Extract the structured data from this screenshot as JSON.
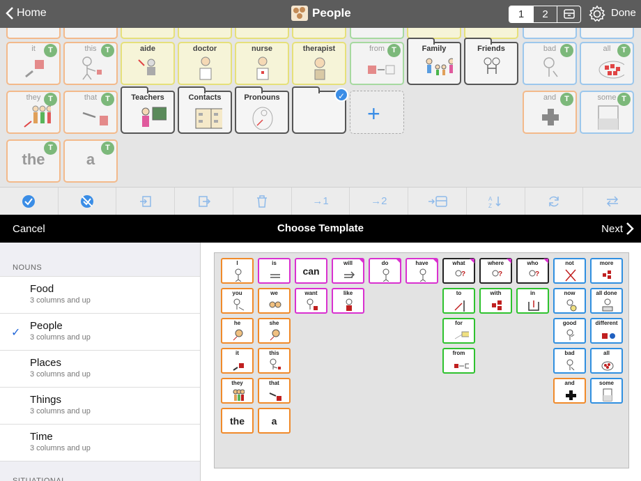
{
  "header": {
    "home_label": "Home",
    "title": "People",
    "pages": [
      "1",
      "2"
    ],
    "done_label": "Done"
  },
  "board": {
    "row1": [
      {
        "label": "it",
        "color": "orange",
        "badge": "T"
      },
      {
        "label": "this",
        "color": "orange",
        "badge": "T"
      },
      {
        "label": "aide",
        "color": "yellow"
      },
      {
        "label": "doctor",
        "color": "yellow"
      },
      {
        "label": "nurse",
        "color": "yellow"
      },
      {
        "label": "therapist",
        "color": "yellow"
      },
      {
        "label": "from",
        "color": "green",
        "badge": "T"
      },
      {
        "label": "Family",
        "color": "folder"
      },
      {
        "label": "Friends",
        "color": "folder"
      },
      {
        "label": "bad",
        "color": "blue",
        "badge": "T"
      },
      {
        "label": "all",
        "color": "blue",
        "badge": "T"
      }
    ],
    "row2": [
      {
        "label": "they",
        "color": "orange",
        "badge": "T"
      },
      {
        "label": "that",
        "color": "orange",
        "badge": "T"
      },
      {
        "label": "Teachers",
        "color": "folder"
      },
      {
        "label": "Contacts",
        "color": "folder"
      },
      {
        "label": "Pronouns",
        "color": "folder"
      },
      {
        "label": "",
        "color": "folder"
      },
      {
        "label": "and",
        "color": "orange",
        "badge": "T"
      },
      {
        "label": "some",
        "color": "blue",
        "badge": "T"
      }
    ],
    "row3": [
      {
        "label": "the",
        "color": "orange",
        "badge": "T"
      },
      {
        "label": "a",
        "color": "orange",
        "badge": "T"
      }
    ]
  },
  "toolbar": {
    "tools": [
      "select-all",
      "deselect-all",
      "import",
      "export",
      "delete",
      "→1",
      "→2",
      "move-to-folder",
      "sort",
      "refresh",
      "swap"
    ]
  },
  "nav": {
    "cancel_label": "Cancel",
    "title": "Choose Template",
    "next_label": "Next"
  },
  "sidebar": {
    "section": "NOUNS",
    "items": [
      {
        "name": "Food",
        "sub": "3 columns and up",
        "selected": false
      },
      {
        "name": "People",
        "sub": "3 columns and up",
        "selected": true
      },
      {
        "name": "Places",
        "sub": "3 columns and up",
        "selected": false
      },
      {
        "name": "Things",
        "sub": "3 columns and up",
        "selected": false
      },
      {
        "name": "Time",
        "sub": "3 columns and up",
        "selected": false
      }
    ],
    "section2": "SITUATIONAL"
  },
  "template": {
    "cells": {
      "I": "I",
      "is": "is",
      "can": "can",
      "will": "will",
      "do": "do",
      "have": "have",
      "what": "what",
      "where": "where",
      "who": "who",
      "not": "not",
      "more": "more",
      "you": "you",
      "we": "we",
      "want": "want",
      "like": "like",
      "to": "to",
      "with": "with",
      "in": "in",
      "now": "now",
      "all_done": "all done",
      "he": "he",
      "she": "she",
      "for": "for",
      "good": "good",
      "different": "different",
      "it": "it",
      "this": "this",
      "from": "from",
      "bad": "bad",
      "all": "all",
      "they": "they",
      "that": "that",
      "and": "and",
      "some": "some",
      "the": "the",
      "a": "a"
    }
  }
}
